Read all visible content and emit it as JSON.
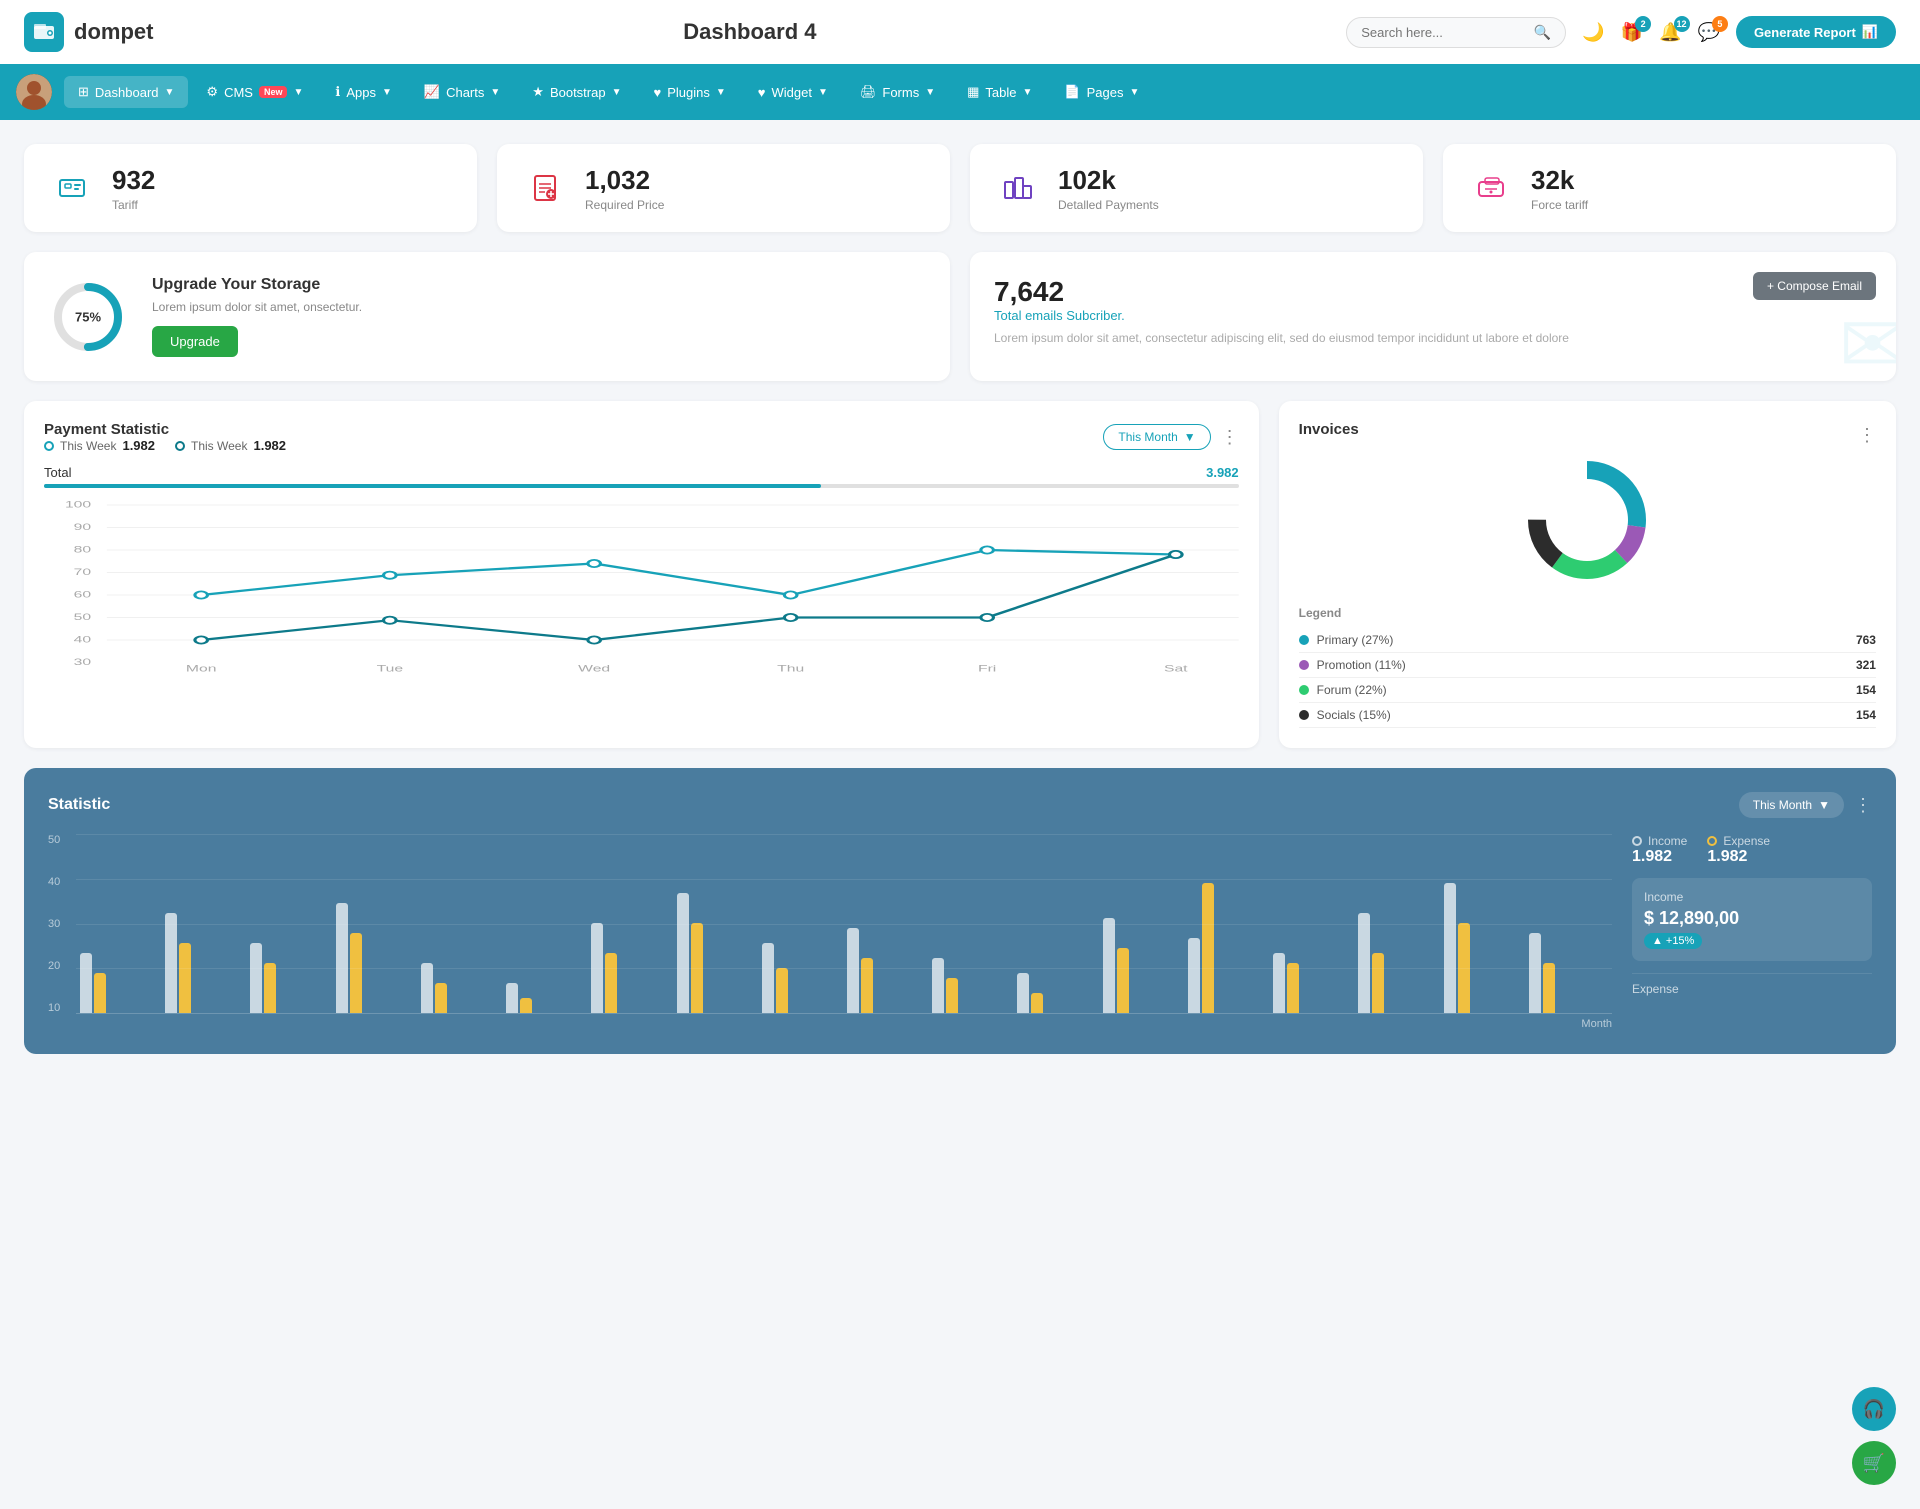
{
  "app": {
    "logo_text": "dompet",
    "page_title": "Dashboard 4",
    "generate_btn": "Generate Report"
  },
  "header": {
    "search_placeholder": "Search here...",
    "icons": {
      "gift_badge": "2",
      "bell_badge": "12",
      "chat_badge": "5"
    }
  },
  "navbar": {
    "items": [
      {
        "label": "Dashboard",
        "active": true,
        "has_dropdown": true
      },
      {
        "label": "CMS",
        "has_badge_new": true,
        "has_dropdown": true
      },
      {
        "label": "Apps",
        "has_dropdown": true
      },
      {
        "label": "Charts",
        "has_dropdown": true
      },
      {
        "label": "Bootstrap",
        "has_dropdown": true
      },
      {
        "label": "Plugins",
        "has_dropdown": true
      },
      {
        "label": "Widget",
        "has_dropdown": true
      },
      {
        "label": "Forms",
        "has_dropdown": true
      },
      {
        "label": "Table",
        "has_dropdown": true
      },
      {
        "label": "Pages",
        "has_dropdown": true
      }
    ]
  },
  "stats": [
    {
      "value": "932",
      "label": "Tariff",
      "icon_type": "teal"
    },
    {
      "value": "1,032",
      "label": "Required Price",
      "icon_type": "red"
    },
    {
      "value": "102k",
      "label": "Detalled Payments",
      "icon_type": "purple"
    },
    {
      "value": "32k",
      "label": "Force tariff",
      "icon_type": "pink"
    }
  ],
  "storage": {
    "percent": "75%",
    "title": "Upgrade Your Storage",
    "desc": "Lorem ipsum dolor sit amet, onsectetur.",
    "btn_label": "Upgrade"
  },
  "email": {
    "count": "7,642",
    "subtitle": "Total emails Subcriber.",
    "desc": "Lorem ipsum dolor sit amet, consectetur adipiscing elit, sed do eiusmod tempor incididunt ut labore et dolore",
    "compose_btn": "+ Compose Email"
  },
  "payment_chart": {
    "title": "Payment Statistic",
    "legend1_label": "This Week",
    "legend1_value": "1.982",
    "legend2_label": "This Week",
    "legend2_value": "1.982",
    "this_month_btn": "This Month",
    "total_label": "Total",
    "total_value": "3.982",
    "x_axis": [
      "Mon",
      "Tue",
      "Wed",
      "Thu",
      "Fri",
      "Sat"
    ],
    "y_axis": [
      "100",
      "90",
      "80",
      "70",
      "60",
      "50",
      "40",
      "30"
    ]
  },
  "invoices": {
    "title": "Invoices",
    "legend_title": "Legend",
    "items": [
      {
        "label": "Primary (27%)",
        "color": "#17a2b8",
        "value": "763",
        "percent": 27
      },
      {
        "label": "Promotion (11%)",
        "color": "#9b59b6",
        "value": "321",
        "percent": 11
      },
      {
        "label": "Forum (22%)",
        "color": "#2ecc71",
        "value": "154",
        "percent": 22
      },
      {
        "label": "Socials (15%)",
        "color": "#2c2c2c",
        "value": "154",
        "percent": 15
      }
    ]
  },
  "statistic": {
    "title": "Statistic",
    "this_month_btn": "This Month",
    "income_label": "Income",
    "income_value": "1.982",
    "expense_label": "Expense",
    "expense_value": "1.982",
    "income_box_label": "Income",
    "income_amount": "$ 12,890,00",
    "growth_badge": "+15%",
    "expense_label2": "Expense",
    "y_labels": [
      "50",
      "40",
      "30",
      "20",
      "10"
    ],
    "month_label": "Month"
  }
}
